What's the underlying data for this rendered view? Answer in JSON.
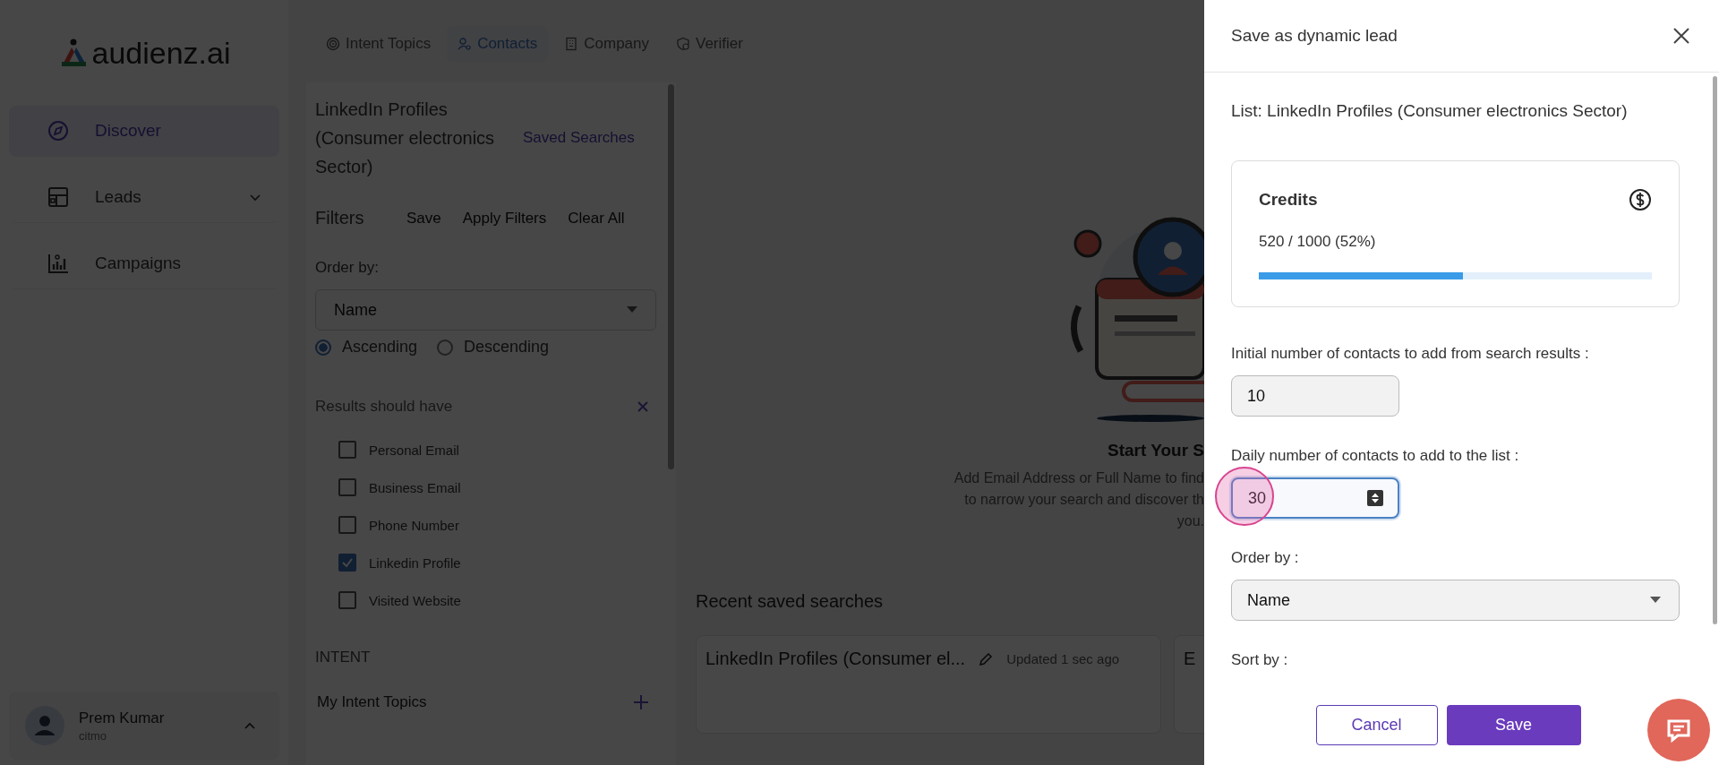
{
  "sidebar": {
    "logo": "audienz.ai",
    "nav": [
      {
        "label": "Discover",
        "selected": true
      },
      {
        "label": "Leads",
        "selected": false,
        "expanded": false
      },
      {
        "label": "Campaigns",
        "selected": false
      }
    ],
    "user": {
      "name": "Prem Kumar",
      "org": "citmo"
    }
  },
  "tabs": [
    {
      "label": "Intent Topics",
      "selected": false
    },
    {
      "label": "Contacts",
      "selected": true
    },
    {
      "label": "Company",
      "selected": false
    },
    {
      "label": "Verifier",
      "selected": false
    }
  ],
  "filters": {
    "title": "LinkedIn Profiles (Consumer electronics Sector)",
    "saved_searches": "Saved Searches",
    "heading": "Filters",
    "actions": [
      "Save",
      "Apply Filters",
      "Clear All"
    ],
    "order_label": "Order by:",
    "order_value": "Name",
    "directions": [
      {
        "label": "Ascending",
        "selected": true
      },
      {
        "label": "Descending",
        "selected": false
      }
    ],
    "results_heading": "Results should have",
    "results_options": [
      {
        "label": "Personal Email",
        "checked": false
      },
      {
        "label": "Business Email",
        "checked": false
      },
      {
        "label": "Phone Number",
        "checked": false
      },
      {
        "label": "Linkedin Profile",
        "checked": true
      },
      {
        "label": "Visited Website",
        "checked": false
      }
    ],
    "intent_heading": "INTENT",
    "intent_item": "My Intent Topics"
  },
  "empty_state": {
    "title": "Start Your S",
    "text": "Add Email Address or Full Name to find\nto narrow your search and discover th\nyou."
  },
  "recent": {
    "heading": "Recent saved searches",
    "cards": [
      {
        "title": "LinkedIn Profiles (Consumer el...",
        "updated": "Updated 1 sec ago"
      },
      {
        "title": "E"
      }
    ]
  },
  "dialog": {
    "title": "Save as dynamic lead",
    "list": "List: LinkedIn Profiles (Consumer electronics Sector)",
    "credits": {
      "title": "Credits",
      "reading": "520 / 1000 (52%)",
      "level": 0.52
    },
    "fields": [
      {
        "kind": "text",
        "label": "Initial number of contacts to add from search results :",
        "value": "10",
        "focused": false
      },
      {
        "kind": "number",
        "label": "Daily number of contacts to add to the list :",
        "value": "30",
        "focused": true
      },
      {
        "kind": "select",
        "label": "Order by :",
        "value": "Name"
      },
      {
        "kind": "label",
        "label": "Sort by :"
      }
    ],
    "buttons": [
      {
        "label": "Cancel",
        "kind": "secondary"
      },
      {
        "label": "Save",
        "kind": "primary"
      }
    ]
  }
}
